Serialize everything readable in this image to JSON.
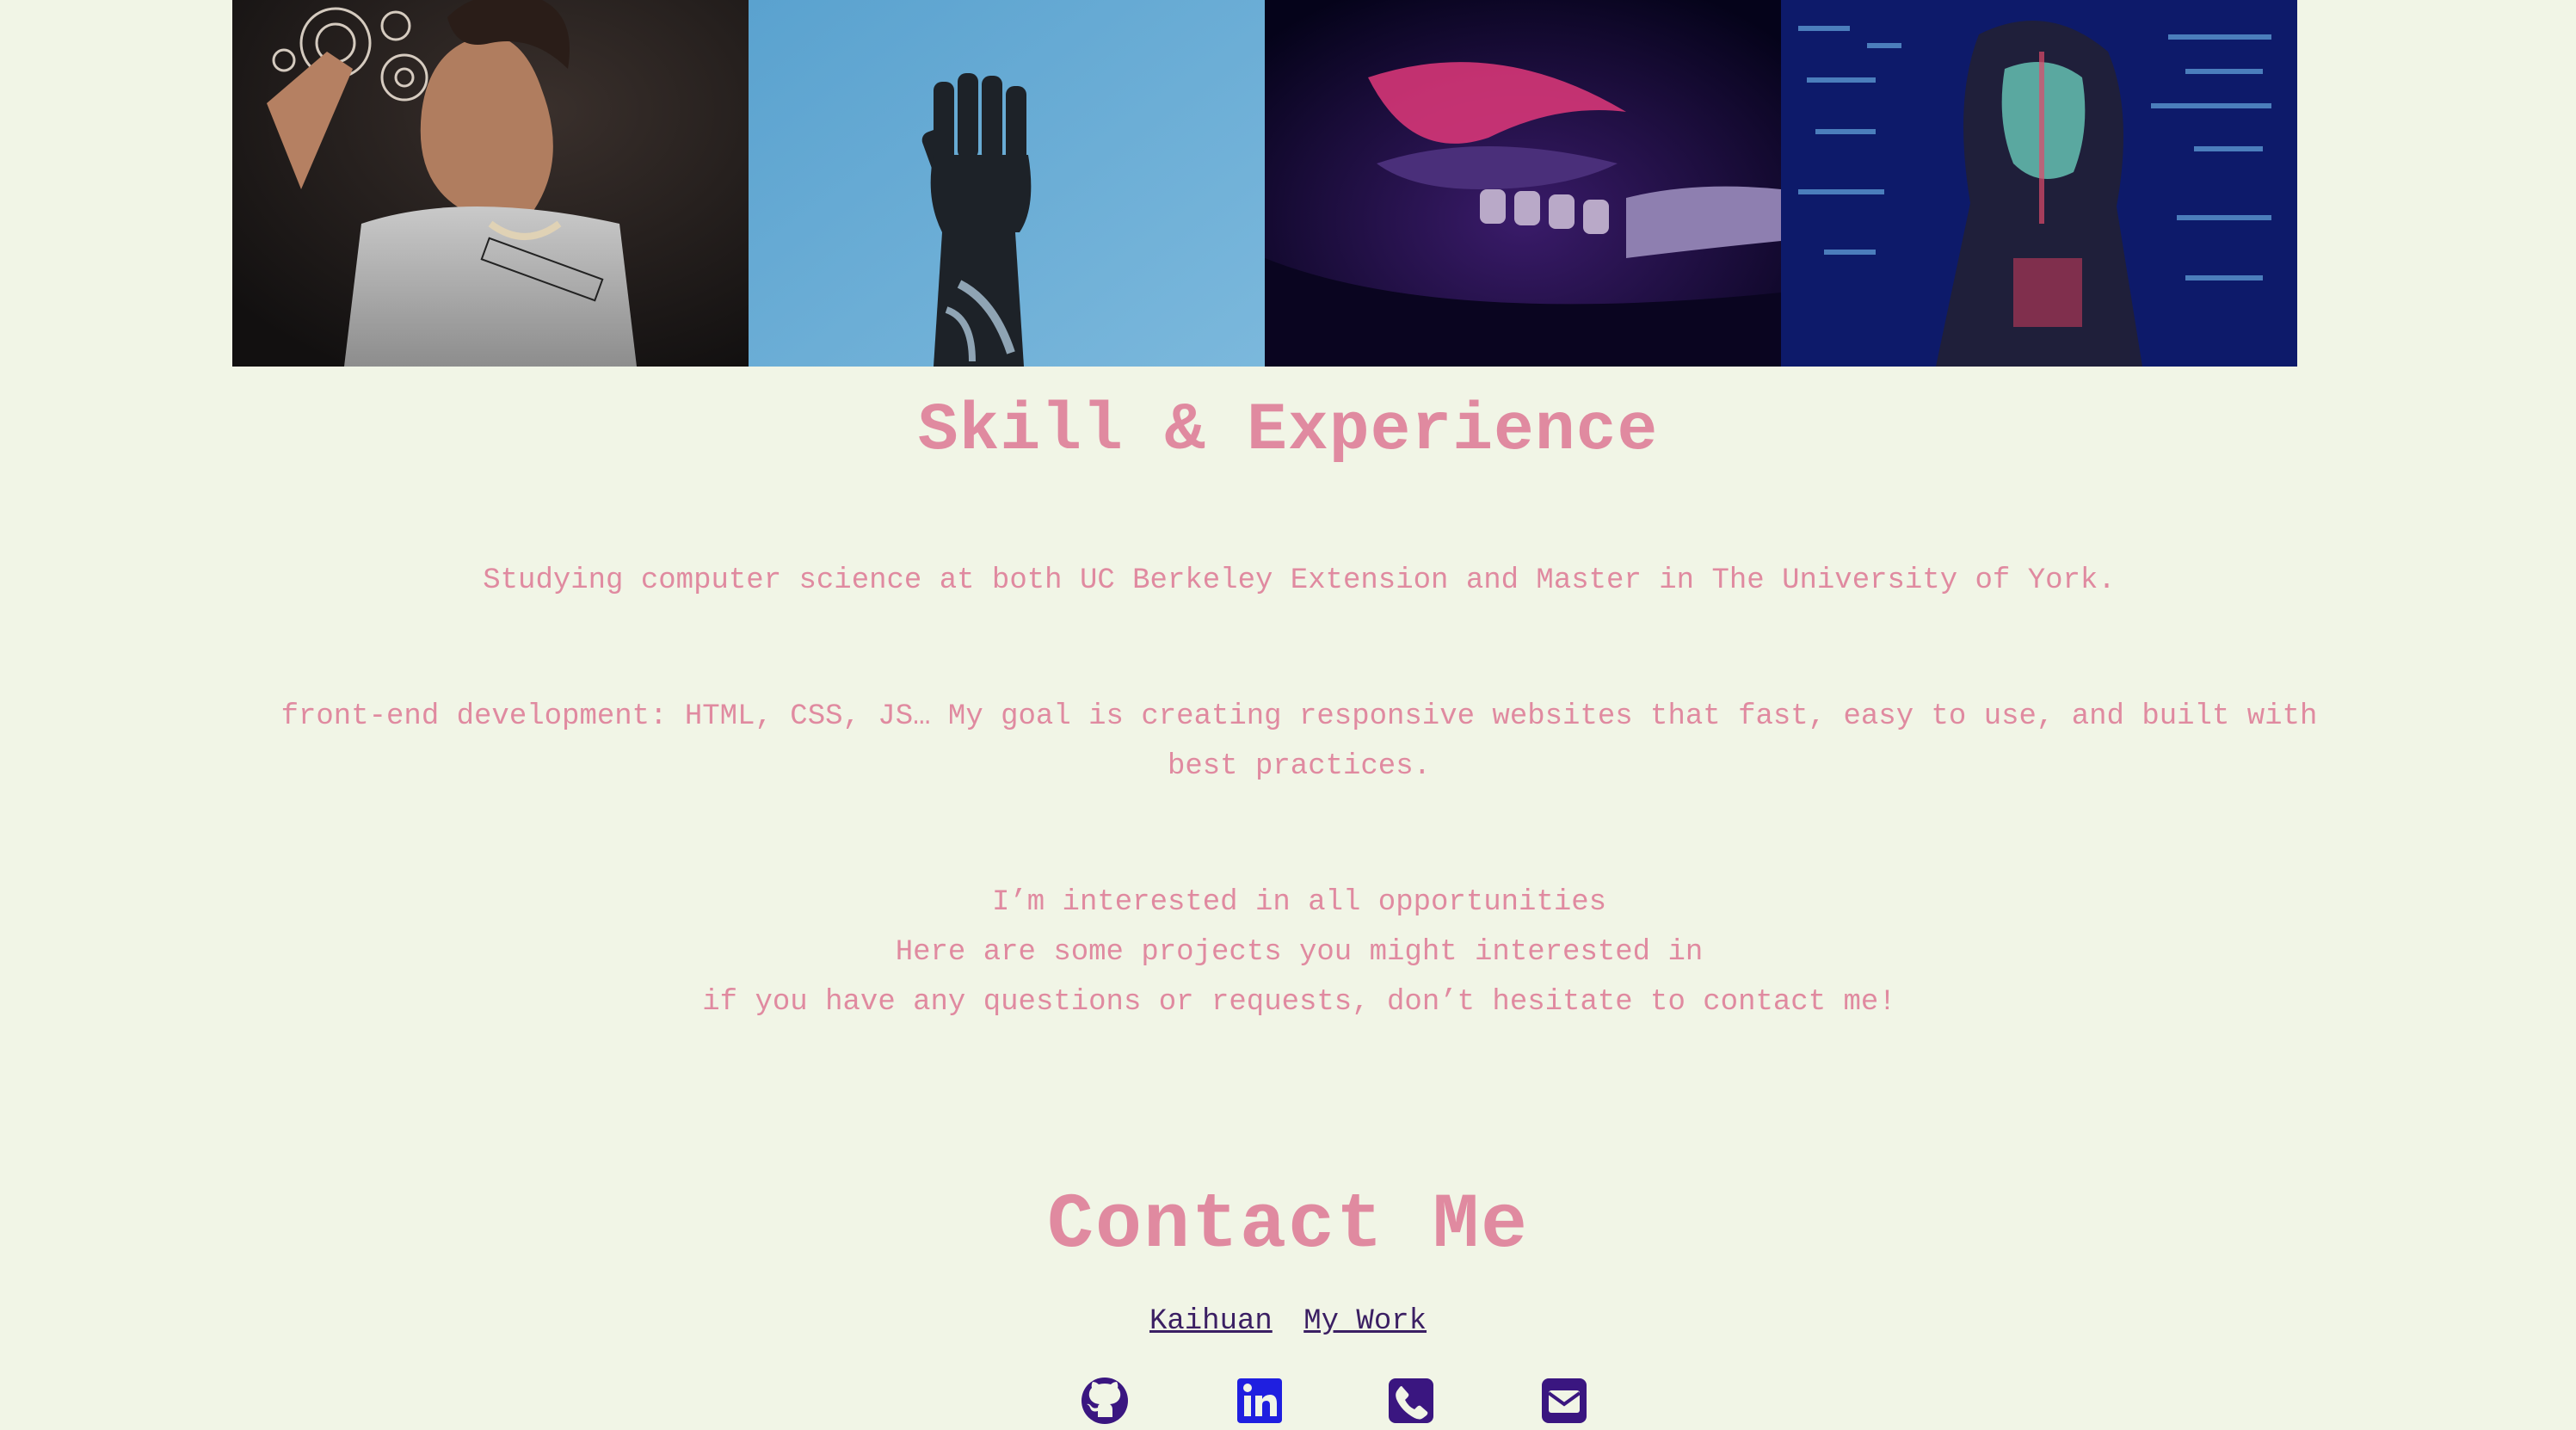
{
  "gallery": {
    "images": [
      {
        "name": "woman-hologram-photo"
      },
      {
        "name": "robotic-hand-photo"
      },
      {
        "name": "robot-hand-neon-photo"
      },
      {
        "name": "code-projection-woman-photo"
      }
    ]
  },
  "skill": {
    "title": "Skill & Experience",
    "p1": "Studying computer science at both UC Berkeley Extension and Master in The University of York.",
    "p2": "front-end development: HTML, CSS, JS… My goal is creating responsive websites that fast, easy to use, and built with best practices.",
    "p3_line1": "I’m interested in all opportunities",
    "p3_line2": "Here are some projects you might interested in",
    "p3_line3": "if you have any questions or requests, don’t hesitate to contact me!"
  },
  "contact": {
    "title": "Contact Me",
    "link1": "Kaihuan",
    "link2": "My Work",
    "icons": [
      "github-icon",
      "linkedin-icon",
      "phone-icon",
      "email-icon"
    ]
  },
  "colors": {
    "background": "#f1f5e6",
    "heading": "#e08aa0",
    "link": "#3b1f63",
    "icon": "#3a1680"
  }
}
